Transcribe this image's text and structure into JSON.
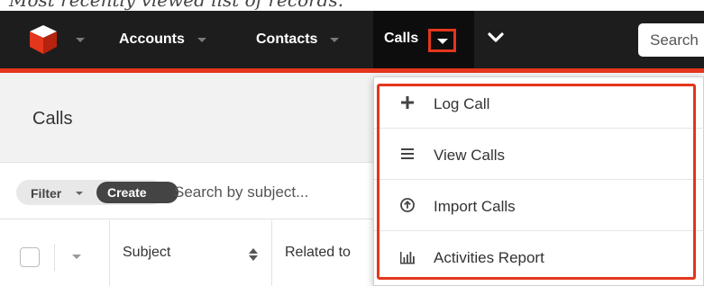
{
  "caption": "Most recently viewed list of records.",
  "navbar": {
    "items": [
      {
        "label": "Accounts"
      },
      {
        "label": "Contacts"
      }
    ],
    "active_module": "Calls",
    "search_placeholder": "Search"
  },
  "list_header": {
    "title": "Calls"
  },
  "filter_bar": {
    "filter_label": "Filter",
    "create_label": "Create",
    "search_placeholder": "Search by subject..."
  },
  "table": {
    "columns": [
      "Subject",
      "Related to"
    ]
  },
  "dropdown": {
    "items": [
      {
        "label": "Log Call",
        "icon": "plus-icon"
      },
      {
        "label": "View Calls",
        "icon": "list-icon"
      },
      {
        "label": "Import Calls",
        "icon": "upload-circle-icon"
      },
      {
        "label": "Activities Report",
        "icon": "bar-chart-icon"
      }
    ]
  },
  "colors": {
    "navbar": "#1d1d1d",
    "accent": "#e4361c",
    "brand_blue": "#1579d6"
  }
}
